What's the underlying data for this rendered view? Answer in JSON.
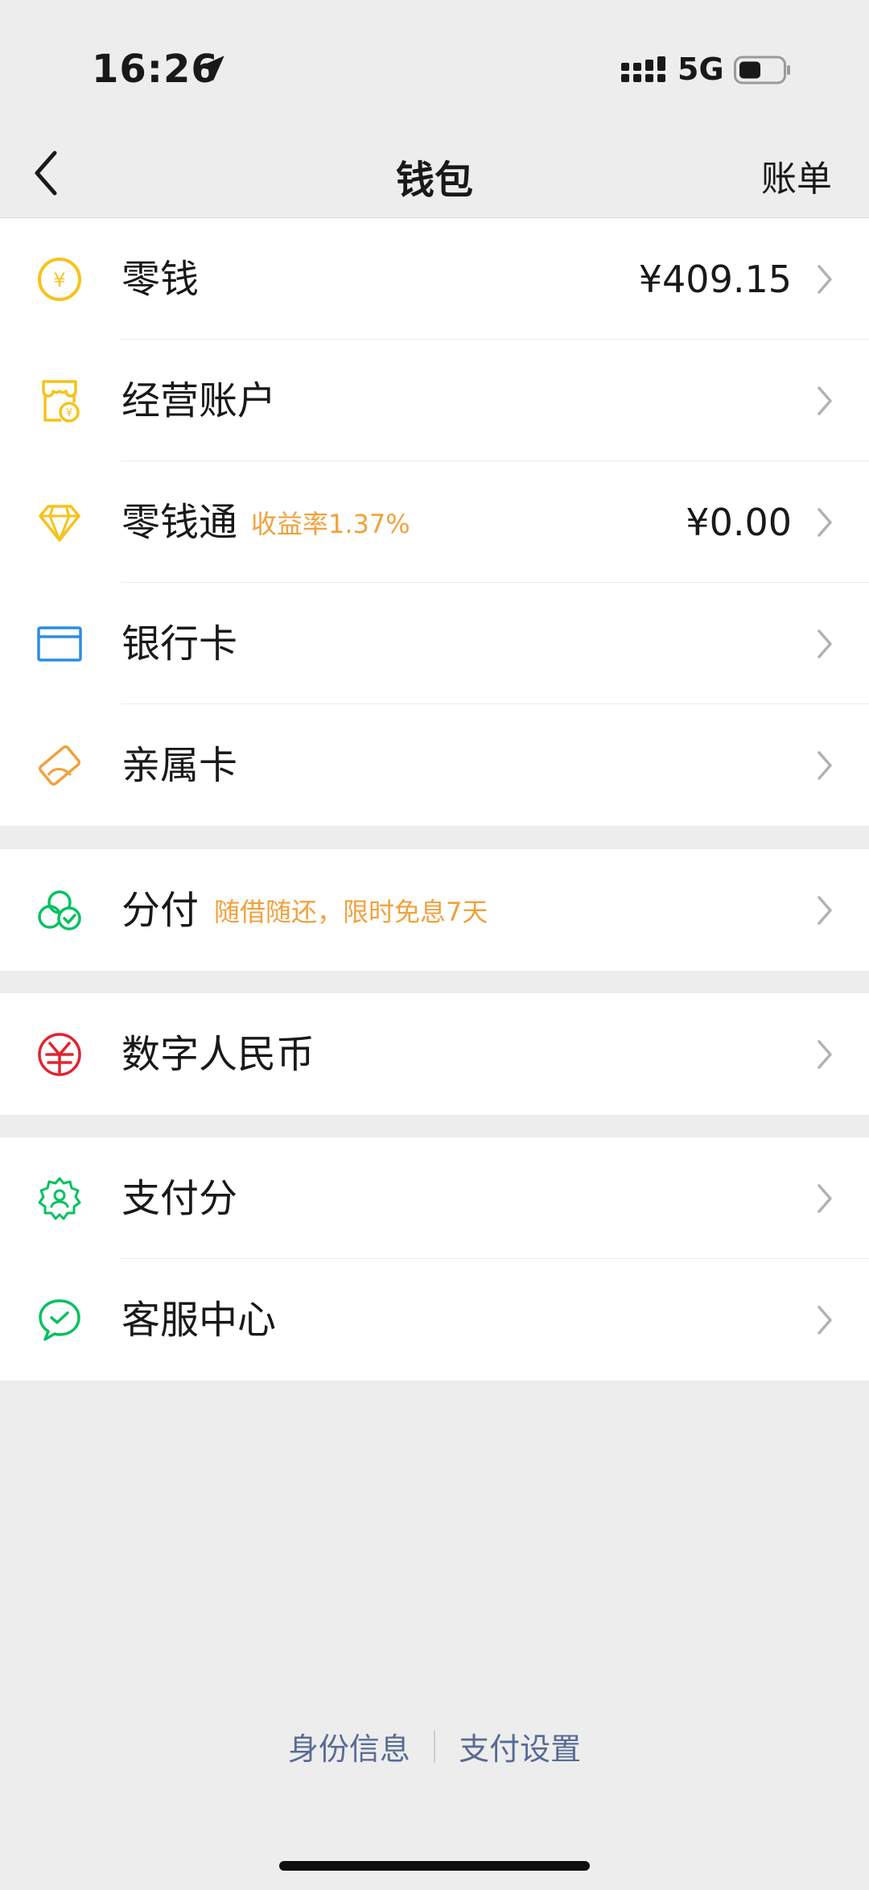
{
  "status_bar": {
    "time": "16:26",
    "network": "5G"
  },
  "nav": {
    "title": "钱包",
    "bill": "账单"
  },
  "groups": [
    {
      "rows": [
        {
          "label": "零钱",
          "value": "¥409.15",
          "icon": "yuan-coin-icon"
        },
        {
          "label": "经营账户",
          "icon": "store-icon"
        },
        {
          "label": "零钱通",
          "tag": "收益率1.37%",
          "value": "¥0.00",
          "icon": "diamond-icon"
        },
        {
          "label": "银行卡",
          "icon": "bank-card-icon"
        },
        {
          "label": "亲属卡",
          "icon": "family-card-icon"
        }
      ]
    },
    {
      "rows": [
        {
          "label": "分付",
          "tag": "随借随还，限时免息7天",
          "icon": "clover-check-icon"
        }
      ]
    },
    {
      "rows": [
        {
          "label": "数字人民币",
          "icon": "digital-rmb-icon"
        }
      ]
    },
    {
      "rows": [
        {
          "label": "支付分",
          "icon": "score-badge-icon"
        },
        {
          "label": "客服中心",
          "icon": "chat-check-icon"
        }
      ]
    }
  ],
  "footer": {
    "identity": "身份信息",
    "settings": "支付设置"
  },
  "colors": {
    "yellow": "#F7C21A",
    "orange": "#F1A13C",
    "blue": "#2B8DE6",
    "green": "#07C160",
    "red": "#E0232F",
    "link": "#576B95"
  }
}
